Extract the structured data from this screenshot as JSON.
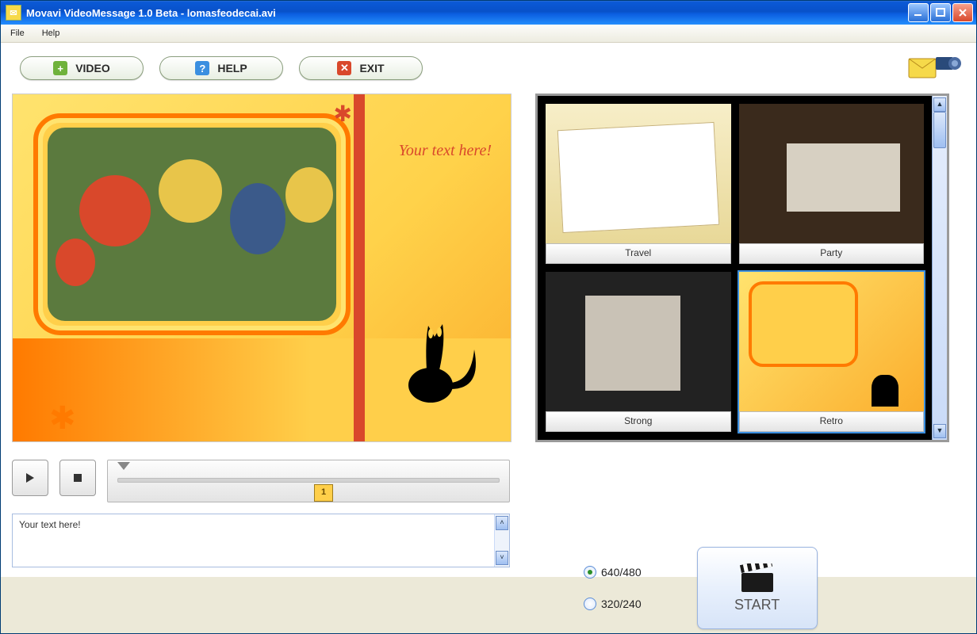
{
  "titlebar": {
    "title": "Movavi VideoMessage 1.0 Beta - lomasfeodecai.avi"
  },
  "menu": {
    "items": [
      "File",
      "Help"
    ]
  },
  "toolbar": {
    "video_label": "VIDEO",
    "help_label": "HELP",
    "exit_label": "EXIT"
  },
  "preview": {
    "placeholder_text": "Your text here!"
  },
  "templates": {
    "items": [
      {
        "label": "Travel",
        "selected": false
      },
      {
        "label": "Party",
        "selected": false
      },
      {
        "label": "Strong",
        "selected": false
      },
      {
        "label": "Retro",
        "selected": true
      }
    ]
  },
  "timeline": {
    "frame_number": "1"
  },
  "textbox": {
    "value": "Your text here!"
  },
  "output": {
    "option_640": "640/480",
    "option_320": "320/240",
    "selected": "640/480",
    "start_label": "START"
  }
}
